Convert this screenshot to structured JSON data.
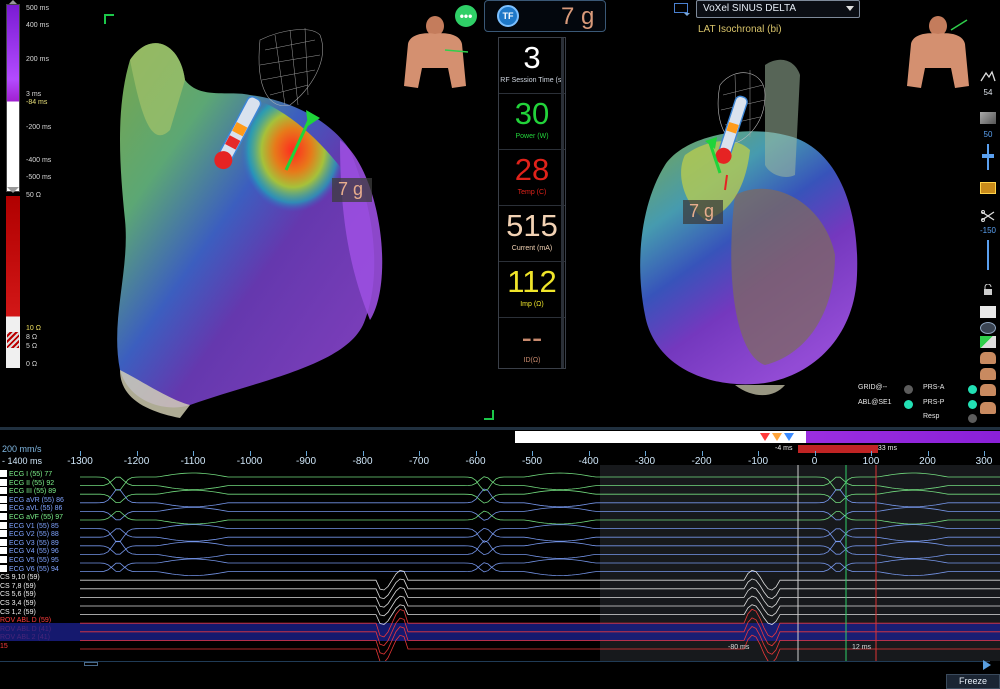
{
  "left_scale": {
    "lat_labels": [
      "500 ms",
      "400 ms",
      "200 ms",
      "3 ms",
      "-84 ms",
      "-200 ms",
      "-400 ms",
      "-500 ms"
    ],
    "imp_labels": [
      "50 Ω",
      "10 Ω",
      "8 Ω",
      "5 Ω",
      "0 Ω"
    ]
  },
  "left_heart": {
    "force": "7 g"
  },
  "right_heart": {
    "force": "7 g"
  },
  "top_bar": {
    "menu_icon": "ellipsis-icon",
    "tf_label": "TF",
    "force": "7 g"
  },
  "ablation": {
    "session_time": {
      "value": "3",
      "label": "RF Session Time (s)",
      "color": "#ffffff"
    },
    "power": {
      "value": "30",
      "label": "Power (W)",
      "color": "#22d33a"
    },
    "temp": {
      "value": "28",
      "label": "Temp (C)",
      "color": "#e0221a"
    },
    "current": {
      "value": "515",
      "label": "Current (mA)",
      "color": "#f2d2b4"
    },
    "impedance": {
      "value": "112",
      "label": "Imp (Ω)",
      "color": "#f0e52a"
    },
    "id": {
      "value": "--",
      "label": "ID(Ω)",
      "color": "#c88a6e"
    }
  },
  "map": {
    "selected": "VoXel SINUS DELTA",
    "subtitle": "LAT Isochronal (bi)"
  },
  "right_tools": {
    "peak_value": "54",
    "opacity_value": "50",
    "threshold_value": "-150"
  },
  "status": {
    "grid": "GRID@--",
    "abl": "ABL@SE1",
    "prs_a": "PRS-A",
    "prs_p": "PRS-P",
    "resp": "Resp"
  },
  "timeline": {
    "sweep_speed": "200 mm/s",
    "window": "- 1400 ms",
    "axis": [
      "-1300",
      "-1200",
      "-1100",
      "-1000",
      "-900",
      "-800",
      "-700",
      "-600",
      "-500",
      "-400",
      "-300",
      "-200",
      "-100",
      "0",
      "100",
      "200",
      "300"
    ],
    "marker_left": "-4 ms",
    "marker_right": "133 ms",
    "meas_left": "-80 ms",
    "meas_right": "12 ms",
    "channels": [
      {
        "name": "ECG I (55)",
        "value": "77",
        "color": "#7cf08a"
      },
      {
        "name": "ECG II (55)",
        "value": "92",
        "color": "#7cf08a"
      },
      {
        "name": "ECG III (55)",
        "value": "89",
        "color": "#7cf08a"
      },
      {
        "name": "ECG aVR (55)",
        "value": "86",
        "color": "#7fa3ff"
      },
      {
        "name": "ECG aVL (55)",
        "value": "86",
        "color": "#7fa3ff"
      },
      {
        "name": "ECG aVF (55)",
        "value": "97",
        "color": "#7cf08a"
      },
      {
        "name": "ECG V1 (55)",
        "value": "85",
        "color": "#7fa3ff"
      },
      {
        "name": "ECG V2 (55)",
        "value": "88",
        "color": "#7fa3ff"
      },
      {
        "name": "ECG V3 (55)",
        "value": "89",
        "color": "#7fa3ff"
      },
      {
        "name": "ECG V4 (55)",
        "value": "96",
        "color": "#7fa3ff"
      },
      {
        "name": "ECG V5 (55)",
        "value": "95",
        "color": "#7fa3ff"
      },
      {
        "name": "ECG V6 (55)",
        "value": "94",
        "color": "#7fa3ff"
      },
      {
        "name": "CS 9,10 (59)",
        "value": "",
        "color": "#f2f2f2"
      },
      {
        "name": "CS 7,8 (59)",
        "value": "",
        "color": "#f2f2f2"
      },
      {
        "name": "CS 5,6 (59)",
        "value": "",
        "color": "#f2f2f2"
      },
      {
        "name": "CS 3,4 (59)",
        "value": "",
        "color": "#f2f2f2"
      },
      {
        "name": "CS 1,2 (59)",
        "value": "",
        "color": "#f2f2f2"
      },
      {
        "name": "ROV ABL D (59)",
        "value": "",
        "color": "#ff3b3b"
      },
      {
        "name": "ROV ABL D (41)",
        "value": "",
        "color": "#ff3b3b"
      },
      {
        "name": "ROV ABL 2 (41)",
        "value": "",
        "color": "#ff3b3b"
      },
      {
        "name": "15",
        "value": "",
        "color": "#ff3b3b"
      }
    ],
    "freeze_label": "Freeze"
  }
}
